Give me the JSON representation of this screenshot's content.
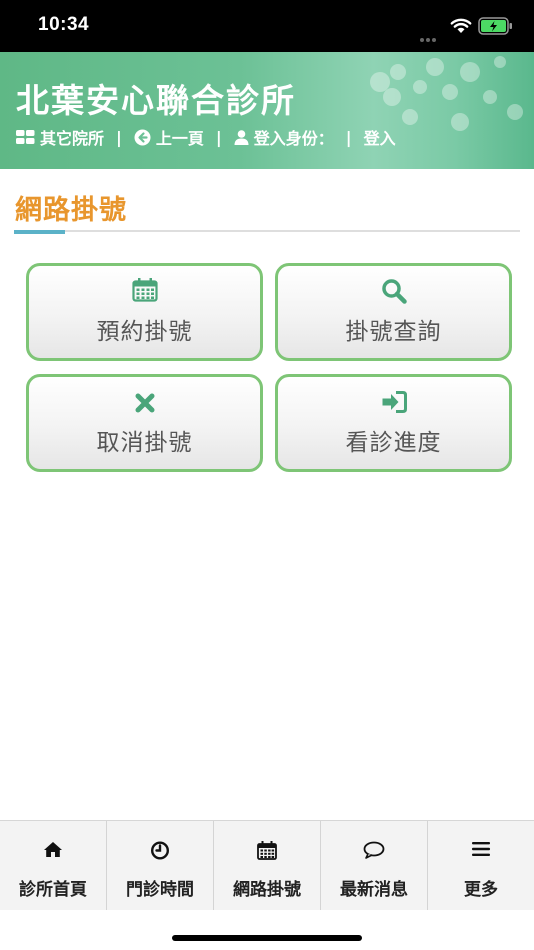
{
  "status_bar": {
    "time": "10:34"
  },
  "header": {
    "title": "北葉安心聯合診所",
    "nav": {
      "other_clinics": "其它院所",
      "back": "上一頁",
      "login_identity": "登入身份：",
      "login": "登入",
      "separator": "|"
    }
  },
  "page": {
    "title": "網路掛號"
  },
  "actions": [
    {
      "label": "預約掛號",
      "icon": "calendar-icon"
    },
    {
      "label": "掛號查詢",
      "icon": "search-icon"
    },
    {
      "label": "取消掛號",
      "icon": "close-icon"
    },
    {
      "label": "看診進度",
      "icon": "sign-in-icon"
    }
  ],
  "tabs": [
    {
      "label": "診所首頁",
      "icon": "home-icon"
    },
    {
      "label": "門診時間",
      "icon": "clock-icon"
    },
    {
      "label": "網路掛號",
      "icon": "calendar-icon"
    },
    {
      "label": "最新消息",
      "icon": "speech-bubble-icon"
    },
    {
      "label": "更多",
      "icon": "menu-icon"
    }
  ],
  "colors": {
    "accent_orange": "#e8962d",
    "button_border_green": "#7ec576",
    "icon_green": "#4aa57a",
    "header_green": "#6cc196",
    "rule_accent_blue": "#5bb2c8"
  }
}
